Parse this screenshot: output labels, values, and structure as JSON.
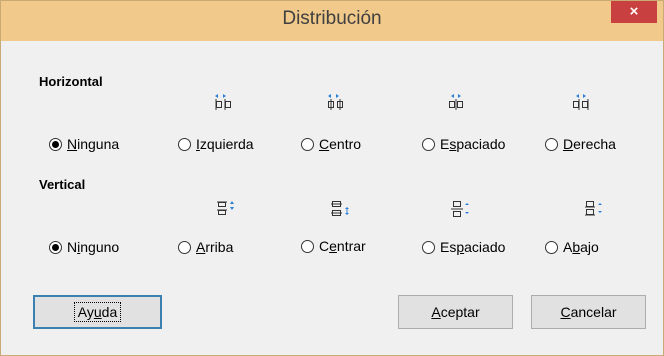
{
  "window": {
    "title": "Distribución",
    "close_label": "×"
  },
  "horizontal": {
    "label": "Horizontal",
    "options": [
      {
        "pre": "",
        "accel": "N",
        "post": "inguna",
        "checked": true,
        "icon": "distribute-none-icon"
      },
      {
        "pre": "",
        "accel": "I",
        "post": "zquierda",
        "checked": false,
        "icon": "distribute-left-icon"
      },
      {
        "pre": "",
        "accel": "C",
        "post": "entro",
        "checked": false,
        "icon": "distribute-center-h-icon"
      },
      {
        "pre": "E",
        "accel": "s",
        "post": "paciado",
        "checked": false,
        "icon": "distribute-spacing-h-icon"
      },
      {
        "pre": "",
        "accel": "D",
        "post": "erecha",
        "checked": false,
        "icon": "distribute-right-icon"
      }
    ]
  },
  "vertical": {
    "label": "Vertical",
    "options": [
      {
        "pre": "N",
        "accel": "i",
        "post": "nguno",
        "checked": true,
        "icon": "distribute-none-icon"
      },
      {
        "pre": "",
        "accel": "A",
        "post": "rriba",
        "checked": false,
        "icon": "distribute-top-icon"
      },
      {
        "pre": "C",
        "accel": "e",
        "post": "ntrar",
        "checked": false,
        "icon": "distribute-center-v-icon"
      },
      {
        "pre": "Es",
        "accel": "p",
        "post": "aciado",
        "checked": false,
        "icon": "distribute-spacing-v-icon"
      },
      {
        "pre": "A",
        "accel": "b",
        "post": "ajo",
        "checked": false,
        "icon": "distribute-bottom-icon"
      }
    ]
  },
  "buttons": {
    "help": {
      "pre": "Ay",
      "accel": "u",
      "post": "da"
    },
    "ok": {
      "pre": "",
      "accel": "A",
      "post": "ceptar"
    },
    "cancel": {
      "pre": "",
      "accel": "C",
      "post": "ancelar"
    }
  },
  "colors": {
    "titlebar": "#f0c98b",
    "close": "#c94040",
    "icon_blue": "#2a7fd4"
  }
}
